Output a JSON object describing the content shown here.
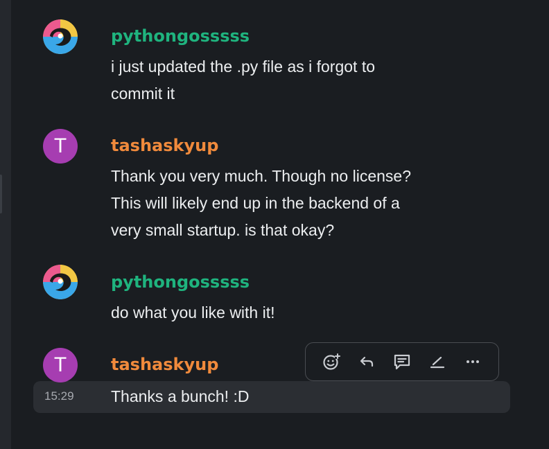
{
  "messages": [
    {
      "author": "pythongosssss",
      "avatar": "colorful-face-avatar",
      "lines": [
        "i just updated the .py file as i forgot to",
        "commit it"
      ]
    },
    {
      "author": "tashaskyup",
      "avatar_letter": "T",
      "lines": [
        "Thank you very much. Though no license?",
        "This will likely end up in the backend of a",
        "very small startup. is that okay?"
      ]
    },
    {
      "author": "pythongosssss",
      "avatar": "colorful-face-avatar",
      "lines": [
        "do what you like with it!"
      ]
    },
    {
      "author": "tashaskyup",
      "avatar_letter": "T",
      "time": "15:29",
      "lines": [
        "Thanks a bunch! :D"
      ]
    }
  ],
  "toolbar": {
    "icons": [
      "add-reaction-icon",
      "reply-icon",
      "thread-icon",
      "edit-icon",
      "more-options-icon"
    ]
  },
  "colors": {
    "background": "#1a1d21",
    "author_green": "#1fb37e",
    "author_orange": "#f08a3c",
    "avatar_purple": "#a63db1",
    "hover_row": "#2b2e33"
  }
}
